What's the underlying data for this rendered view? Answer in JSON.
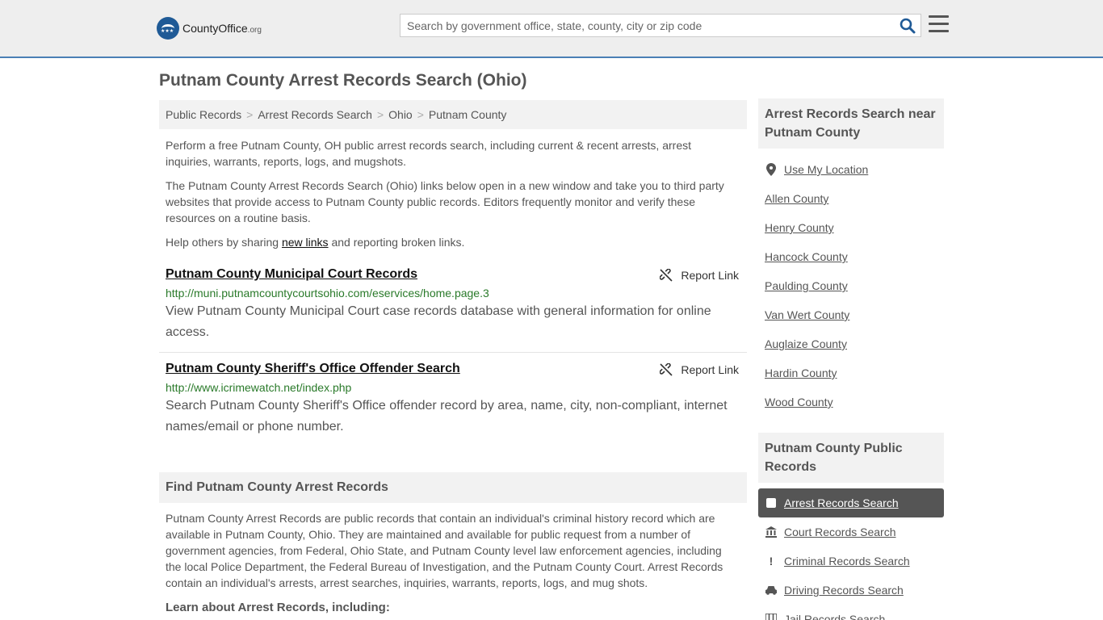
{
  "logo": {
    "name": "CountyOffice",
    "tld": ".org"
  },
  "search": {
    "placeholder": "Search by government office, state, county, city or zip code"
  },
  "page_title": "Putnam County Arrest Records Search (Ohio)",
  "breadcrumb": [
    "Public Records",
    "Arrest Records Search",
    "Ohio",
    "Putnam County"
  ],
  "intro": {
    "p1": "Perform a free Putnam County, OH public arrest records search, including current & recent arrests, arrest inquiries, warrants, reports, logs, and mugshots.",
    "p2": "The Putnam County Arrest Records Search (Ohio) links below open in a new window and take you to third party websites that provide access to Putnam County public records. Editors frequently monitor and verify these resources on a routine basis.",
    "p3_before": "Help others by sharing ",
    "p3_link": "new links",
    "p3_after": " and reporting broken links."
  },
  "report_label": "Report Link",
  "records": [
    {
      "title": "Putnam County Municipal Court Records",
      "url": "http://muni.putnamcountycourtsohio.com/eservices/home.page.3",
      "desc": "View Putnam County Municipal Court case records database with general information for online access."
    },
    {
      "title": "Putnam County Sheriff's Office Offender Search",
      "url": "http://www.icrimewatch.net/index.php",
      "desc": "Search Putnam County Sheriff's Office offender record by area, name, city, non-compliant, internet names/email or phone number."
    }
  ],
  "find_section": {
    "title": "Find Putnam County Arrest Records",
    "text": "Putnam County Arrest Records are public records that contain an individual's criminal history record which are available in Putnam County, Ohio. They are maintained and available for public request from a number of government agencies, from Federal, Ohio State, and Putnam County level law enforcement agencies, including the local Police Department, the Federal Bureau of Investigation, and the Putnam County Court. Arrest Records contain an individual's arrests, arrest searches, inquiries, warrants, reports, logs, and mug shots.",
    "learn": "Learn about Arrest Records, including:"
  },
  "sidebar": {
    "near_title": "Arrest Records Search near Putnam County",
    "use_location": "Use My Location",
    "near_items": [
      "Allen County",
      "Henry County",
      "Hancock County",
      "Paulding County",
      "Van Wert County",
      "Auglaize County",
      "Hardin County",
      "Wood County"
    ],
    "public_title": "Putnam County Public Records",
    "public_items": [
      {
        "label": "Arrest Records Search",
        "icon": "checkbox-icon",
        "active": true
      },
      {
        "label": "Court Records Search",
        "icon": "courthouse-icon",
        "active": false
      },
      {
        "label": "Criminal Records Search",
        "icon": "exclamation-icon",
        "active": false
      },
      {
        "label": "Driving Records Search",
        "icon": "car-icon",
        "active": false
      },
      {
        "label": "Jail Records Search",
        "icon": "jail-icon",
        "active": false
      }
    ]
  }
}
